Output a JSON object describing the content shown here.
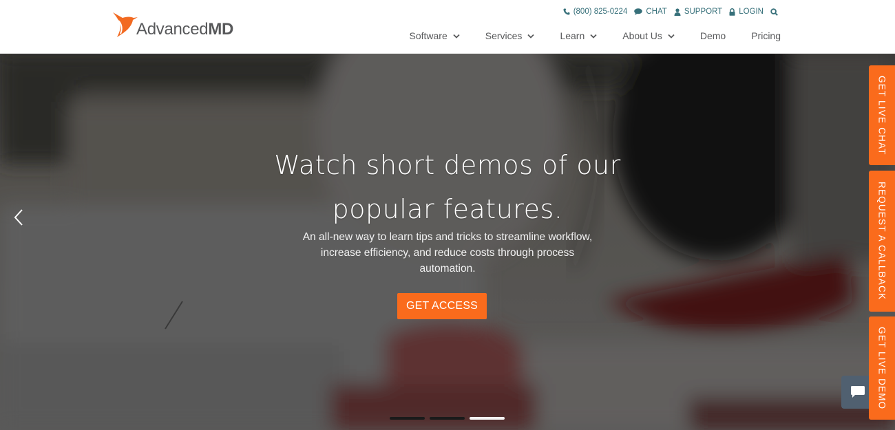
{
  "brand": {
    "name_regular": "Advanced",
    "name_bold": "MD",
    "accent_color": "#fa6b1c",
    "utility_color": "#37707a"
  },
  "utility_bar": {
    "phone": "(800) 825-0224",
    "chat": "CHAT",
    "support": "SUPPORT",
    "login": "LOGIN",
    "search_icon": "search-icon"
  },
  "nav": {
    "items": [
      {
        "label": "Software",
        "has_dropdown": true
      },
      {
        "label": "Services",
        "has_dropdown": true
      },
      {
        "label": "Learn",
        "has_dropdown": true
      },
      {
        "label": "About Us",
        "has_dropdown": true
      },
      {
        "label": "Demo",
        "has_dropdown": false
      },
      {
        "label": "Pricing",
        "has_dropdown": false
      }
    ]
  },
  "hero": {
    "title_line1": "Watch short demos of our",
    "title_line2": "popular features.",
    "subtitle_line1": "An all-new way to learn tips and tricks to streamline workflow,",
    "subtitle_line2": "increase efficiency, and reduce costs through process",
    "subtitle_line3": "automation.",
    "cta_label": "GET ACCESS",
    "slides_total": 3,
    "active_slide": 3
  },
  "side_tabs": {
    "live_chat": "GET LIVE CHAT",
    "callback": "REQUEST A CALLBACK",
    "live_demo": "GET LIVE DEMO"
  }
}
